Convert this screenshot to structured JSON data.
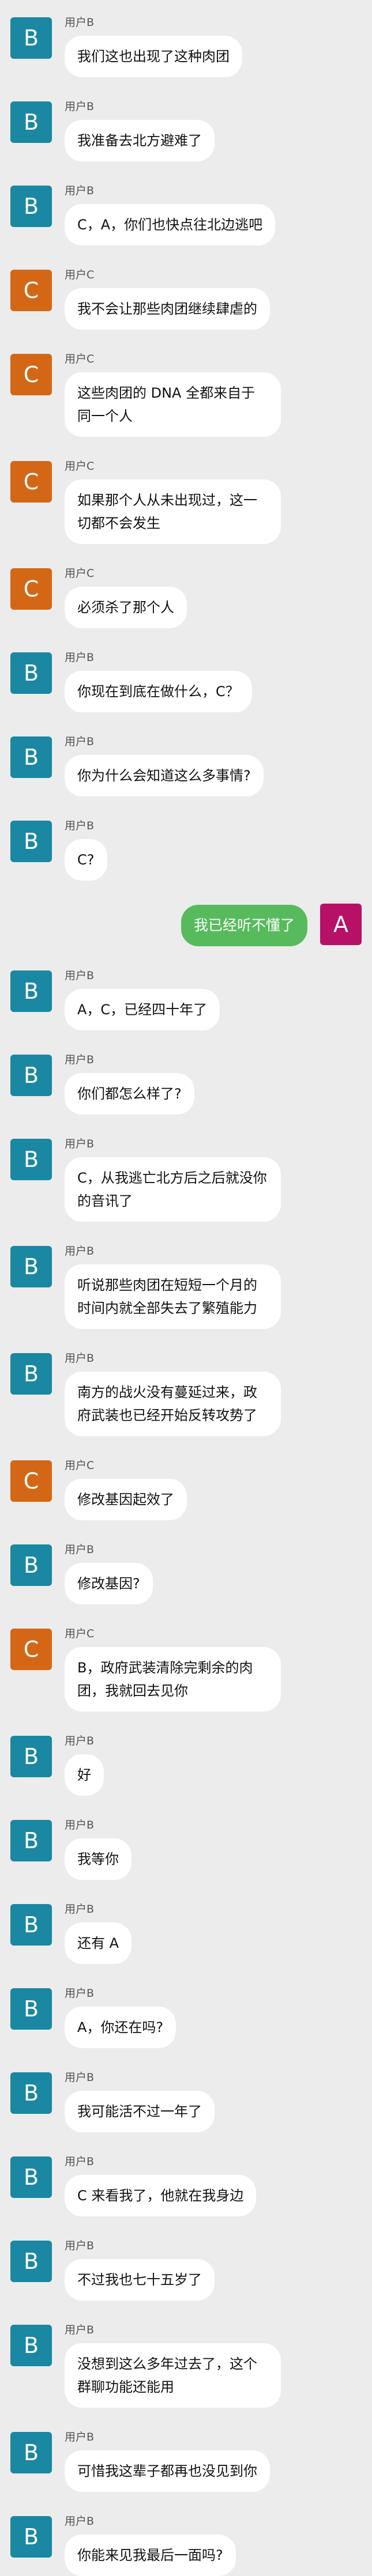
{
  "colors": {
    "background": "#ececec",
    "bubble_in": "#ffffff",
    "bubble_out": "#57bb5e",
    "avatar_B": "#1a87a3",
    "avatar_C": "#d46716",
    "avatar_A": "#b61166"
  },
  "messages": [
    {
      "side": "left",
      "avatar": "B",
      "sender": "用户B",
      "text": "我们这也出现了这种肉团",
      "gap": 0
    },
    {
      "side": "left",
      "avatar": "B",
      "sender": "用户B",
      "text": "我准备去北方避难了",
      "gap": 42
    },
    {
      "side": "left",
      "avatar": "B",
      "sender": "用户B",
      "text": "C，A，你们也快点往北边逃吧",
      "gap": 42
    },
    {
      "side": "left",
      "avatar": "C",
      "sender": "用户C",
      "text": "我不会让那些肉团继续肆虐的",
      "gap": 42
    },
    {
      "side": "left",
      "avatar": "C",
      "sender": "用户C",
      "text": "这些肉团的 DNA 全都来自于同一个人",
      "gap": 42
    },
    {
      "side": "left",
      "avatar": "C",
      "sender": "用户C",
      "text": "如果那个人从未出现过，这一切都不会发生",
      "gap": 42
    },
    {
      "side": "left",
      "avatar": "C",
      "sender": "用户C",
      "text": "必须杀了那个人",
      "gap": 42
    },
    {
      "side": "left",
      "avatar": "B",
      "sender": "用户B",
      "text": "你现在到底在做什么，C？",
      "gap": 42
    },
    {
      "side": "left",
      "avatar": "B",
      "sender": "用户B",
      "text": "你为什么会知道这么多事情?",
      "gap": 42
    },
    {
      "side": "left",
      "avatar": "B",
      "sender": "用户B",
      "text": "C?",
      "gap": 42
    },
    {
      "side": "right",
      "avatar": "A",
      "sender": "",
      "text": "我已经听不懂了",
      "gap": 40
    },
    {
      "side": "left",
      "avatar": "B",
      "sender": "用户B",
      "text": "A，C，已经四十年了",
      "gap": 42
    },
    {
      "side": "left",
      "avatar": "B",
      "sender": "用户B",
      "text": "你们都怎么样了?",
      "gap": 42
    },
    {
      "side": "left",
      "avatar": "B",
      "sender": "用户B",
      "text": "C，从我逃亡北方后之后就没你的音讯了",
      "gap": 42
    },
    {
      "side": "left",
      "avatar": "B",
      "sender": "用户B",
      "text": "听说那些肉团在短短一个月的时间内就全部失去了繁殖能力",
      "gap": 42
    },
    {
      "side": "left",
      "avatar": "B",
      "sender": "用户B",
      "text": "南方的战火没有蔓延过来，政府武装也已经开始反转攻势了",
      "gap": 42
    },
    {
      "side": "left",
      "avatar": "C",
      "sender": "用户C",
      "text": "修改基因起效了",
      "gap": 42
    },
    {
      "side": "left",
      "avatar": "B",
      "sender": "用户B",
      "text": "修改基因?",
      "gap": 42
    },
    {
      "side": "left",
      "avatar": "C",
      "sender": "用户C",
      "text": "B，政府武装清除完剩余的肉团，我就回去见你",
      "gap": 42
    },
    {
      "side": "left",
      "avatar": "B",
      "sender": "用户B",
      "text": "好",
      "gap": 42
    },
    {
      "side": "left",
      "avatar": "B",
      "sender": "用户B",
      "text": "我等你",
      "gap": 42
    },
    {
      "side": "left",
      "avatar": "B",
      "sender": "用户B",
      "text": "还有 A",
      "gap": 42
    },
    {
      "side": "left",
      "avatar": "B",
      "sender": "用户B",
      "text": "A，你还在吗?",
      "gap": 42
    },
    {
      "side": "left",
      "avatar": "B",
      "sender": "用户B",
      "text": "我可能活不过一年了",
      "gap": 42
    },
    {
      "side": "left",
      "avatar": "B",
      "sender": "用户B",
      "text": "C 来看我了，他就在我身边",
      "gap": 42
    },
    {
      "side": "left",
      "avatar": "B",
      "sender": "用户B",
      "text": "不过我也七十五岁了",
      "gap": 42
    },
    {
      "side": "left",
      "avatar": "B",
      "sender": "用户B",
      "text": "没想到这么多年过去了，这个群聊功能还能用",
      "gap": 42
    },
    {
      "side": "left",
      "avatar": "B",
      "sender": "用户B",
      "text": "可惜我这辈子都再也没见到你",
      "gap": 42
    },
    {
      "side": "left",
      "avatar": "B",
      "sender": "用户B",
      "text": "你能来见我最后一面吗?",
      "gap": 42
    }
  ]
}
